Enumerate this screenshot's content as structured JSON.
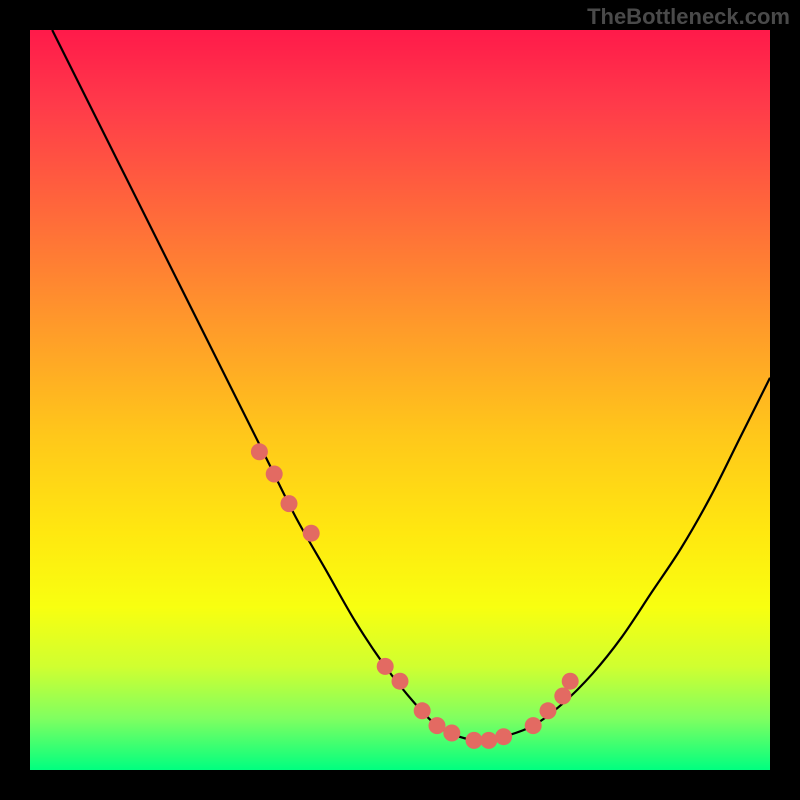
{
  "watermark": "TheBottleneck.com",
  "chart_data": {
    "type": "line",
    "title": "",
    "xlabel": "",
    "ylabel": "",
    "xlim": [
      0,
      100
    ],
    "ylim": [
      0,
      100
    ],
    "grid": false,
    "series": [
      {
        "name": "curve",
        "type": "line",
        "color": "#000000",
        "x": [
          3,
          8,
          12,
          16,
          20,
          24,
          28,
          32,
          36,
          40,
          44,
          48,
          52,
          55,
          58,
          61,
          64,
          68,
          72,
          76,
          80,
          84,
          88,
          92,
          96,
          100
        ],
        "y": [
          100,
          90,
          82,
          74,
          66,
          58,
          50,
          42,
          34,
          27,
          20,
          14,
          9,
          6,
          4.5,
          4,
          4.5,
          6,
          9,
          13,
          18,
          24,
          30,
          37,
          45,
          53
        ]
      },
      {
        "name": "highlight-points",
        "type": "scatter",
        "color": "#e36a62",
        "x": [
          31,
          33,
          35,
          38,
          48,
          50,
          53,
          55,
          57,
          60,
          62,
          64,
          68,
          70,
          72,
          73
        ],
        "y": [
          43,
          40,
          36,
          32,
          14,
          12,
          8,
          6,
          5,
          4,
          4,
          4.5,
          6,
          8,
          10,
          12
        ]
      }
    ]
  }
}
